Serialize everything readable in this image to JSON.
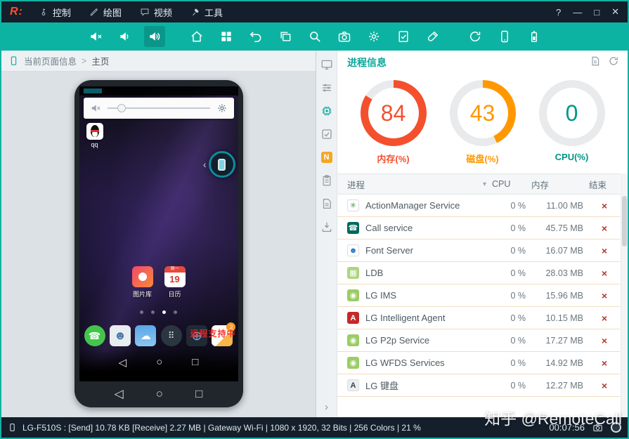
{
  "titlebar": {
    "logo": "R:",
    "menus": [
      {
        "label": "控制"
      },
      {
        "label": "绘图"
      },
      {
        "label": "视频"
      },
      {
        "label": "工具"
      }
    ],
    "help": "?"
  },
  "toolbar": {
    "icons": [
      {
        "name": "volume-mute",
        "icon": "volume-mute"
      },
      {
        "name": "volume-low",
        "icon": "volume-low"
      },
      {
        "name": "volume-high",
        "icon": "volume-high",
        "active": true
      },
      {
        "name": "home",
        "icon": "home",
        "gap": true
      },
      {
        "name": "apps-grid",
        "icon": "apps"
      },
      {
        "name": "undo",
        "icon": "undo"
      },
      {
        "name": "windows",
        "icon": "windows"
      },
      {
        "name": "search",
        "icon": "search"
      },
      {
        "name": "screenshot",
        "icon": "camera"
      },
      {
        "name": "settings",
        "icon": "gear"
      },
      {
        "name": "tasks-check",
        "icon": "tasks"
      },
      {
        "name": "draw-brush",
        "icon": "brush"
      },
      {
        "name": "refresh",
        "icon": "refresh",
        "gap": true
      },
      {
        "name": "phone-rotate",
        "icon": "phone"
      },
      {
        "name": "battery",
        "icon": "battery"
      }
    ]
  },
  "breadcrumb": {
    "items": [
      "当前页面信息",
      "主页"
    ],
    "separator": ">"
  },
  "phone": {
    "qq_label": "qq",
    "apps": {
      "gallery": "图片库",
      "calendar": "日历",
      "calendar_week": "周一",
      "calendar_day": "19"
    },
    "overlay_text": "远程支持中",
    "nav": {
      "back": "◁",
      "home": "○",
      "recents": "□"
    }
  },
  "sidebar": {
    "items": [
      {
        "name": "screen-info",
        "icon": "screen"
      },
      {
        "name": "device-controls",
        "icon": "sliders"
      },
      {
        "name": "process-info",
        "icon": "chip",
        "active": true
      },
      {
        "name": "permissions",
        "icon": "checkbox"
      },
      {
        "name": "notifications",
        "badge": "N"
      },
      {
        "name": "clipboard",
        "icon": "clipboard"
      },
      {
        "name": "logs",
        "icon": "document"
      },
      {
        "name": "import",
        "icon": "import"
      }
    ],
    "expand_arrow": "›"
  },
  "process_panel": {
    "title": "进程信息",
    "gauges": [
      {
        "id": "memory",
        "value": 84,
        "label": "内存(%)",
        "color": "#f4502e"
      },
      {
        "id": "disk",
        "value": 43,
        "label": "磁盘(%)",
        "color": "#ff9800"
      },
      {
        "id": "cpu",
        "value": 0,
        "label": "CPU(%)",
        "color": "#009688"
      }
    ],
    "table": {
      "headers": [
        "进程",
        "CPU",
        "内存",
        "结束"
      ],
      "rows": [
        {
          "name": "ActionManager Service",
          "cpu": "0 %",
          "mem": "11.00 MB",
          "icon": {
            "name": "actionmanager",
            "bg": "#ffffff",
            "fg": "#43a047",
            "glyph": "✳",
            "border": true
          }
        },
        {
          "name": "Call service",
          "cpu": "0 %",
          "mem": "45.75 MB",
          "icon": {
            "name": "call-service",
            "bg": "#00695c",
            "fg": "#ffffff",
            "glyph": "☎"
          }
        },
        {
          "name": "Font Server",
          "cpu": "0 %",
          "mem": "16.07 MB",
          "icon": {
            "name": "font-server",
            "bg": "#ffffff",
            "fg": "#1e78c8",
            "glyph": "☻",
            "border": true
          }
        },
        {
          "name": "LDB",
          "cpu": "0 %",
          "mem": "28.03 MB",
          "icon": {
            "name": "ldb",
            "bg": "#aed581",
            "fg": "#ffffff",
            "glyph": "▦"
          }
        },
        {
          "name": "LG IMS",
          "cpu": "0 %",
          "mem": "15.96 MB",
          "icon": {
            "name": "lg-ims",
            "bg": "#9ccc65",
            "fg": "#ffffff",
            "glyph": "◉"
          }
        },
        {
          "name": "LG Intelligent Agent",
          "cpu": "0 %",
          "mem": "10.15 MB",
          "icon": {
            "name": "lg-intelligent-agent",
            "bg": "#c62828",
            "fg": "#ffffff",
            "glyph": "A"
          }
        },
        {
          "name": "LG P2p Service",
          "cpu": "0 %",
          "mem": "17.27 MB",
          "icon": {
            "name": "lg-p2p-service",
            "bg": "#9ccc65",
            "fg": "#ffffff",
            "glyph": "◉"
          }
        },
        {
          "name": "LG WFDS Services",
          "cpu": "0 %",
          "mem": "14.92 MB",
          "icon": {
            "name": "lg-wfds-services",
            "bg": "#9ccc65",
            "fg": "#ffffff",
            "glyph": "◉"
          }
        },
        {
          "name": "LG 键盘",
          "cpu": "0 %",
          "mem": "12.27 MB",
          "icon": {
            "name": "lg-keyboard",
            "bg": "#eceff1",
            "fg": "#37474f",
            "glyph": "A",
            "border": true
          }
        }
      ]
    }
  },
  "statusbar": {
    "device_info": "LG-F510S : [Send] 10.78 KB  [Receive] 2.27 MB | Gateway Wi-Fi | 1080 x 1920, 32 Bits | 256 Colors | 21 %",
    "time": "00:07:56",
    "watermark": "知乎 @RemoteCall"
  }
}
